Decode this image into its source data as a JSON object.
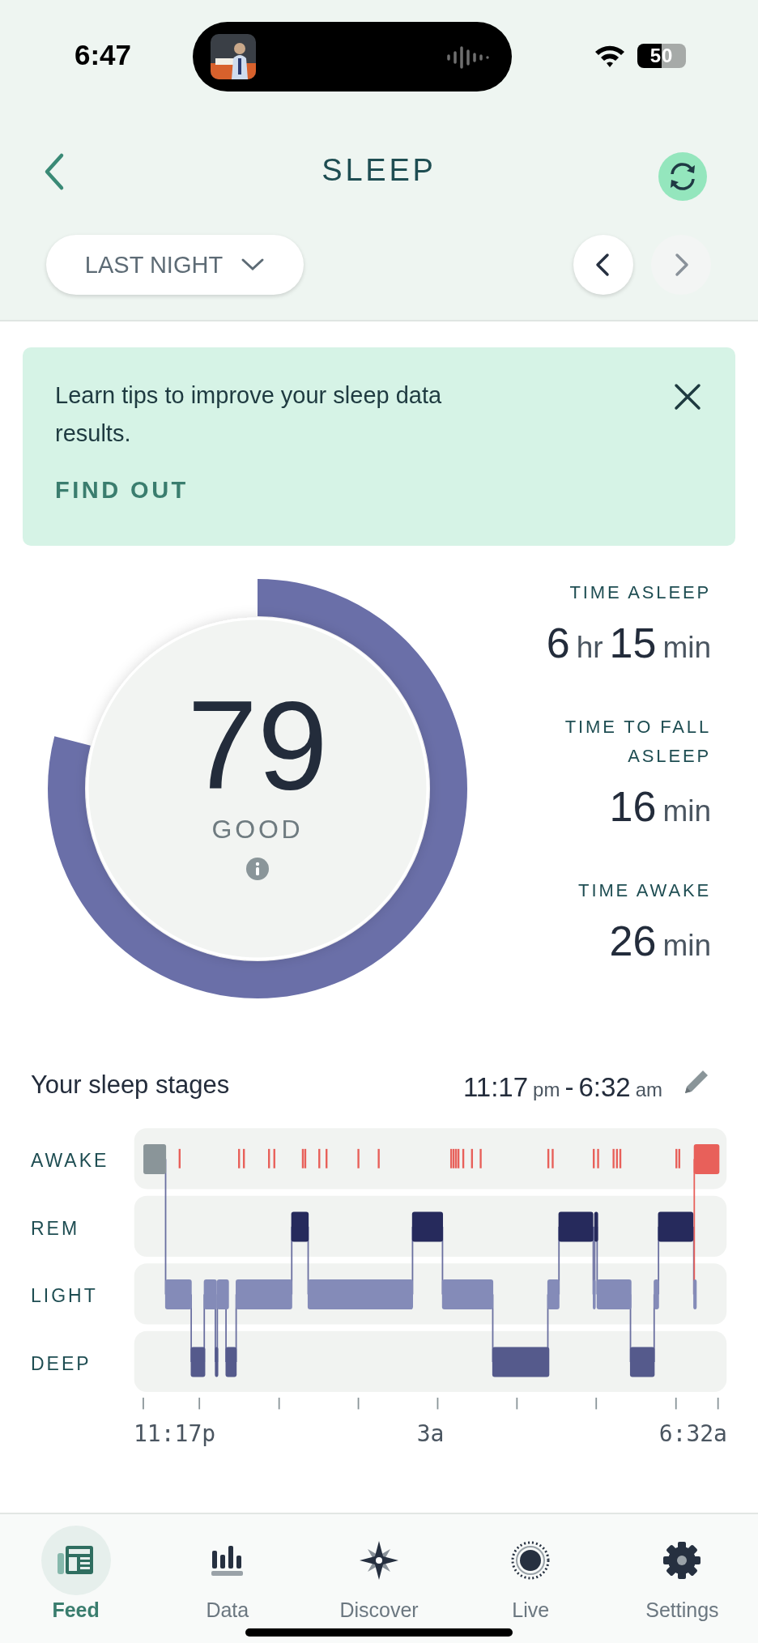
{
  "status_bar": {
    "time": "6:47",
    "battery": "50"
  },
  "header": {
    "title": "SLEEP"
  },
  "period": {
    "label": "LAST NIGHT"
  },
  "date_nav": [
    {
      "disabled": false
    },
    {
      "disabled": true
    }
  ],
  "banner": {
    "text": "Learn tips to improve your sleep data results.",
    "link": "FIND OUT"
  },
  "score": {
    "value": "79",
    "rating": "GOOD",
    "level": 0.79
  },
  "stats": [
    {
      "label": "TIME ASLEEP",
      "parts": [
        {
          "text": "6",
          "kind": "number"
        },
        {
          "text": "hr",
          "kind": "unit"
        },
        {
          "text": "15",
          "kind": "number"
        },
        {
          "text": "min",
          "kind": "unit"
        }
      ]
    },
    {
      "label": "TIME TO FALL ASLEEP",
      "parts": [
        {
          "text": "16",
          "kind": "number"
        },
        {
          "text": "min",
          "kind": "unit"
        }
      ]
    },
    {
      "label": "TIME AWAKE",
      "parts": [
        {
          "text": "26",
          "kind": "number"
        },
        {
          "text": "min",
          "kind": "unit"
        }
      ]
    }
  ],
  "stages": {
    "title": "Your sleep stages",
    "range": [
      {
        "text": "11:17",
        "kind": "number"
      },
      {
        "text": "pm",
        "kind": "unit"
      },
      {
        "text": "-",
        "kind": "number"
      },
      {
        "text": "6:32",
        "kind": "number"
      },
      {
        "text": "am",
        "kind": "unit"
      }
    ],
    "rows": [
      "AWAKE",
      "REM",
      "LIGHT",
      "DEEP"
    ],
    "axis_labels": [
      "11:17p",
      "3a",
      "6:32a"
    ]
  },
  "tabs": [
    {
      "label": "Feed",
      "selected": true
    },
    {
      "label": "Data",
      "selected": false
    },
    {
      "label": "Discover",
      "selected": false
    },
    {
      "label": "Live",
      "selected": false
    },
    {
      "label": "Settings",
      "selected": false
    }
  ]
}
